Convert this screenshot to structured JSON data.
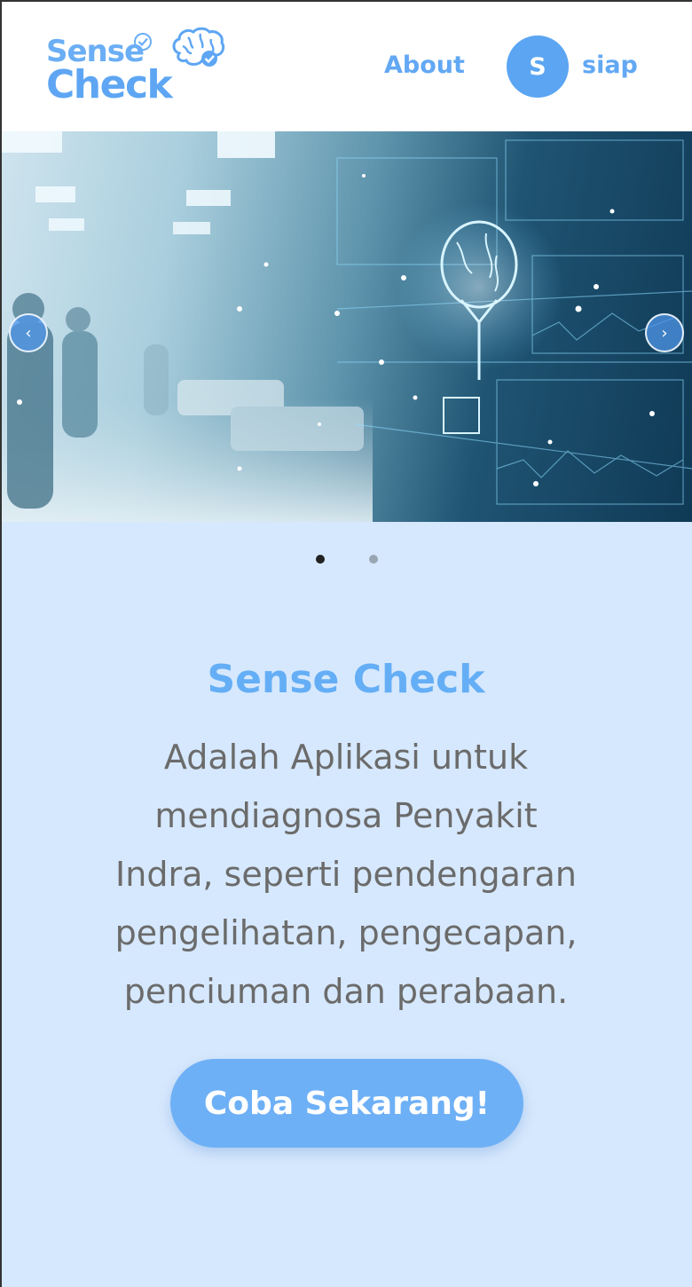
{
  "header": {
    "logo_line1": "Sense",
    "logo_line2": "Check",
    "nav_about": "About",
    "avatar_initial": "S",
    "username": "siap"
  },
  "carousel": {
    "prev_icon": "chevron-left-icon",
    "next_icon": "chevron-right-icon",
    "prev_glyph": "‹",
    "next_glyph": "›",
    "active_slide": 1,
    "slide_count": 2
  },
  "main": {
    "title": "Sense Check",
    "description": "Adalah Aplikasi untuk mendiagnosa Penyakit Indra, seperti pendengaran pengelihatan, pengecapan, penciuman dan perabaan.",
    "cta_label": "Coba Sekarang!"
  },
  "colors": {
    "accent": "#5ea6f3",
    "background": "#d6e8fd",
    "text": "#6b6b6b",
    "button": "#6eb0f6"
  }
}
